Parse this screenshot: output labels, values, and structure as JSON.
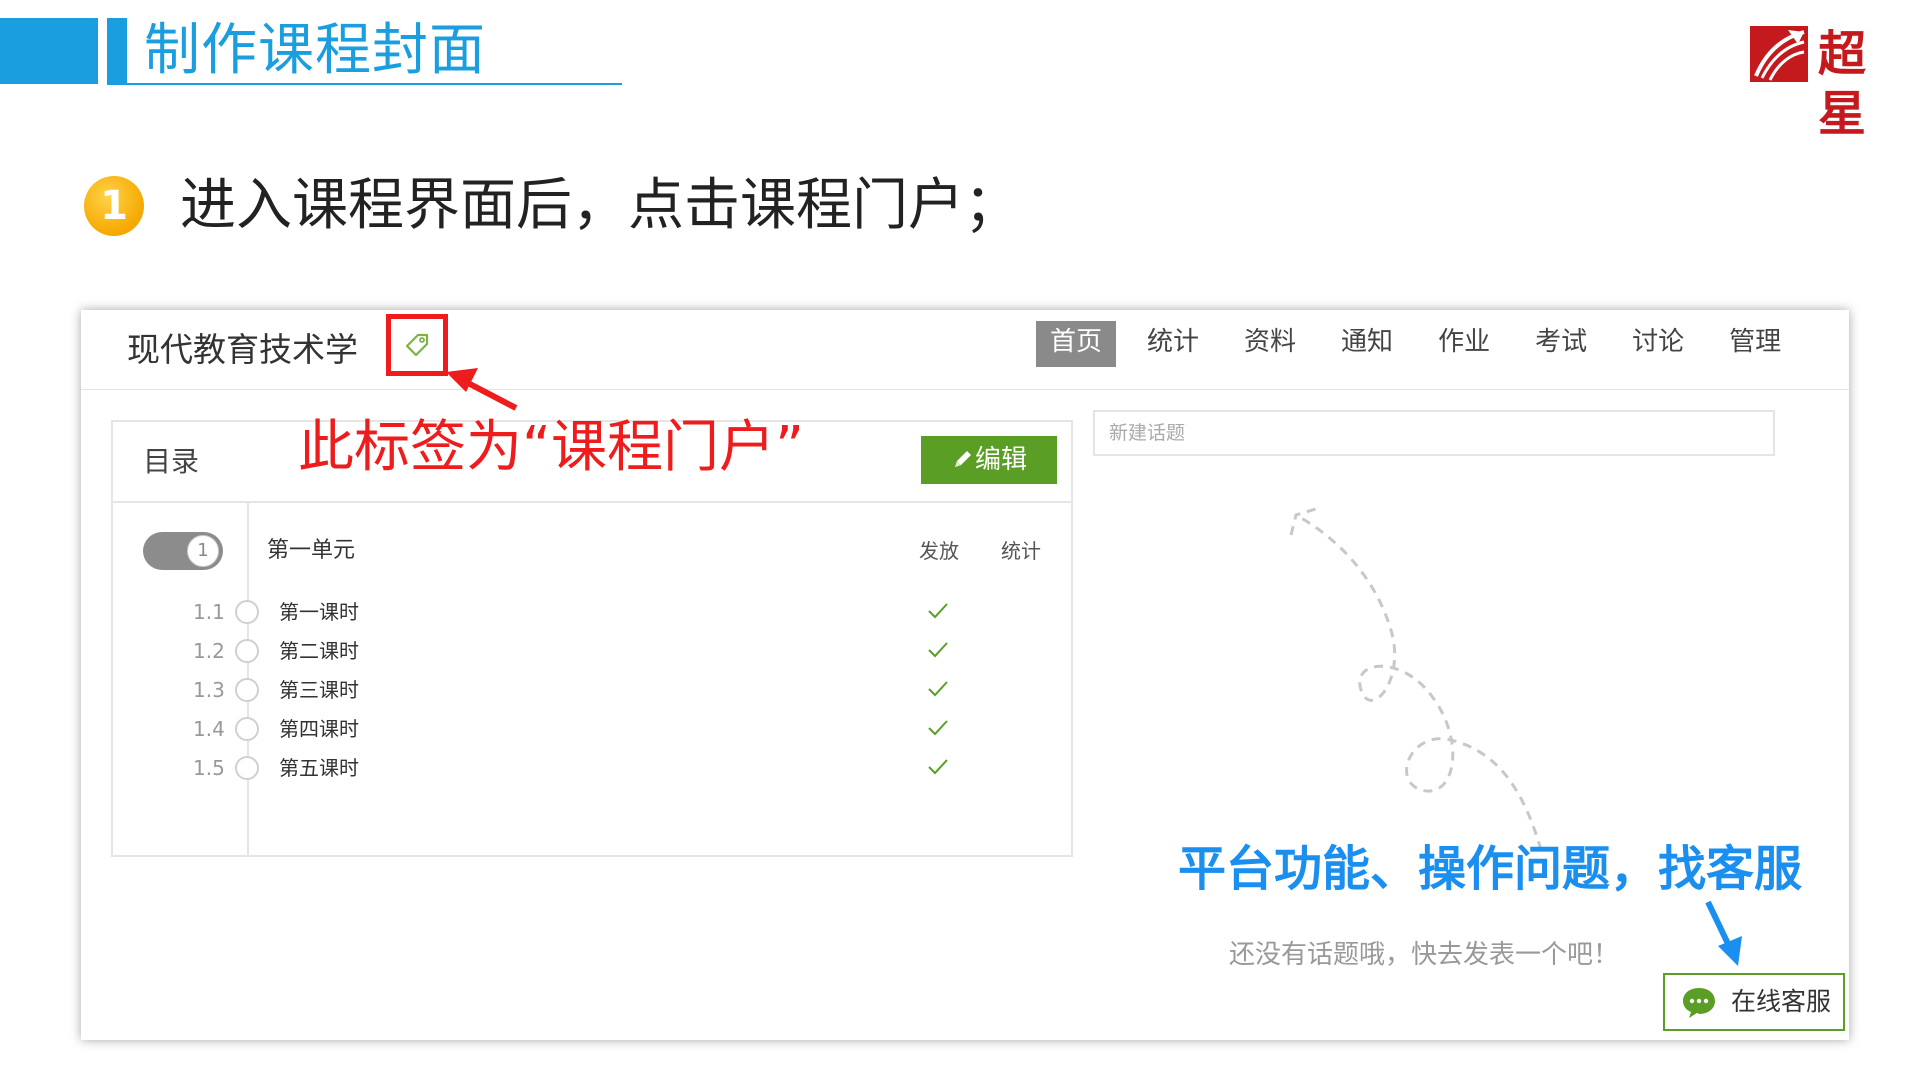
{
  "slide": {
    "title": "制作课程封面",
    "logo_text": "超星",
    "step_number": "1",
    "step_text": "进入课程界面后，点击课程门户；"
  },
  "app": {
    "course_name": "现代教育技术学",
    "nav": [
      "首页",
      "统计",
      "资料",
      "通知",
      "作业",
      "考试",
      "讨论",
      "管理"
    ],
    "nav_active": "首页",
    "catalog": {
      "title": "目录",
      "edit_label": "编辑",
      "unit": {
        "index": "1",
        "title": "第一单元"
      },
      "columns": [
        "发放",
        "统计"
      ],
      "lessons": [
        {
          "num": "1.1",
          "name": "第一课时",
          "released": true
        },
        {
          "num": "1.2",
          "name": "第二课时",
          "released": true
        },
        {
          "num": "1.3",
          "name": "第三课时",
          "released": true
        },
        {
          "num": "1.4",
          "name": "第四课时",
          "released": true
        },
        {
          "num": "1.5",
          "name": "第五课时",
          "released": true
        }
      ]
    },
    "topics": {
      "new_topic_placeholder": "新建话题",
      "empty_text": "还没有话题哦，快去发表一个吧！",
      "service_label": "在线客服"
    }
  },
  "annotations": {
    "tag_note": "此标签为“课程门户”",
    "service_note": "平台功能、操作问题，找客服"
  },
  "colors": {
    "brand_blue": "#1b9ee0",
    "annotation_red": "#ee1c1c",
    "annotation_blue": "#1a8ff0",
    "button_green": "#5a9e25",
    "nav_active_bg": "#8a8a8a",
    "logo_red": "#c41a1e"
  },
  "icons": [
    "tag-icon",
    "pencil-icon",
    "check-icon",
    "chat-bubble-icon",
    "chaoxing-logo-mark"
  ]
}
